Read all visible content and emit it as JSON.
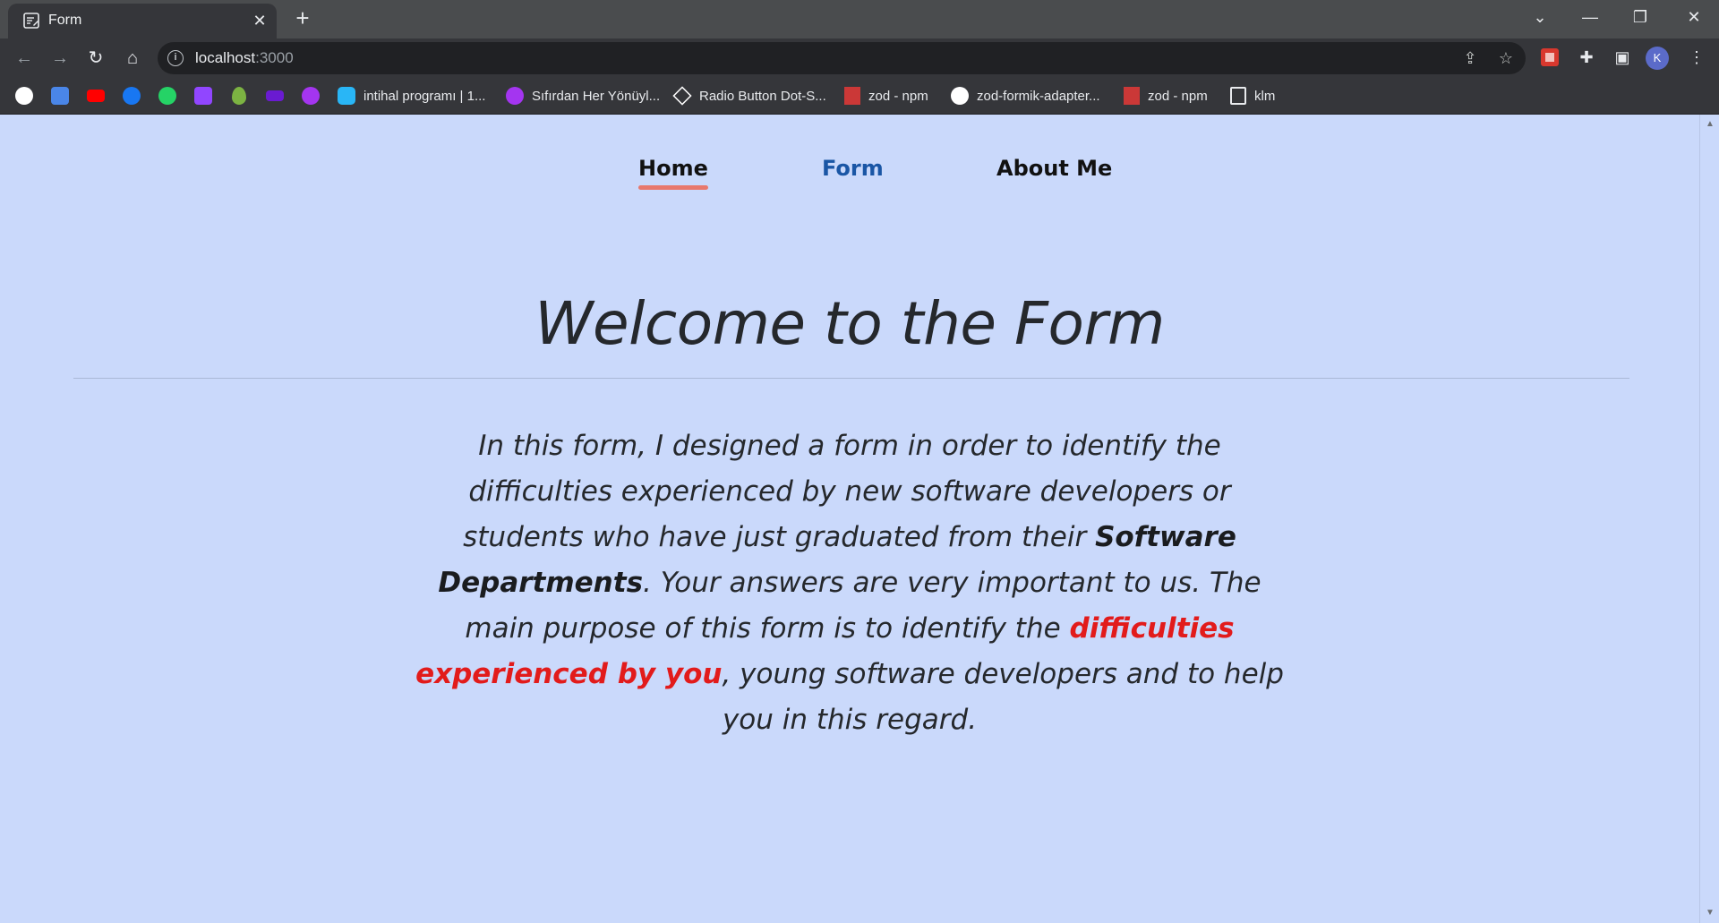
{
  "browser": {
    "tab_title": "Form",
    "tab_close": "✕",
    "new_tab": "+",
    "url_host": "localhost",
    "url_port": ":3000",
    "profile_initial": "K"
  },
  "bookmarks": [
    {
      "label": "",
      "icon": "google-icon",
      "color": "#ffffff"
    },
    {
      "label": "",
      "icon": "google-translate-icon",
      "color": "#4a86e8"
    },
    {
      "label": "",
      "icon": "youtube-icon",
      "color": "#ff0000"
    },
    {
      "label": "",
      "icon": "facebook-icon",
      "color": "#1877f2"
    },
    {
      "label": "",
      "icon": "whatsapp-icon",
      "color": "#25d366"
    },
    {
      "label": "",
      "icon": "twitch-icon",
      "color": "#9146ff"
    },
    {
      "label": "",
      "icon": "drop-icon",
      "color": "#7cb342"
    },
    {
      "label": "",
      "icon": "mail-icon",
      "color": "#6a1bd1"
    },
    {
      "label": "",
      "icon": "udemy-icon",
      "color": "#a435f0"
    },
    {
      "label": "intihal programı | 1...",
      "icon": "plagiarism-icon",
      "color": "#29b6f6"
    },
    {
      "label": "Sıfırdan Her Yönüyl...",
      "icon": "udemy-icon",
      "color": "#a435f0"
    },
    {
      "label": "Radio Button Dot-S...",
      "icon": "codepen-icon",
      "color": "#ffffff"
    },
    {
      "label": "zod - npm",
      "icon": "npm-icon",
      "color": "#cb3837"
    },
    {
      "label": "zod-formik-adapter...",
      "icon": "github-icon",
      "color": "#ffffff"
    },
    {
      "label": "zod - npm",
      "icon": "npm-icon",
      "color": "#cb3837"
    },
    {
      "label": "klm",
      "icon": "page-icon",
      "color": "#ffffff"
    }
  ],
  "nav": {
    "home": "Home",
    "form": "Form",
    "about": "About Me"
  },
  "main": {
    "title": "Welcome to the Form",
    "intro_part1": "In this form, I designed a form in order to identify the difficulties experienced by new software developers or students who have just graduated from their ",
    "intro_bold": "Software Departments",
    "intro_part2": ". Your answers are very important to us. The main purpose of this form is to identify the ",
    "intro_red": "difficulties experienced by you",
    "intro_part3": ", young software developers and to help you in this regard."
  },
  "colors": {
    "page_bg": "#cad9fb",
    "active_nav": "#1a56a5",
    "underline": "#e8786d",
    "highlight_red": "#e21b1b"
  }
}
